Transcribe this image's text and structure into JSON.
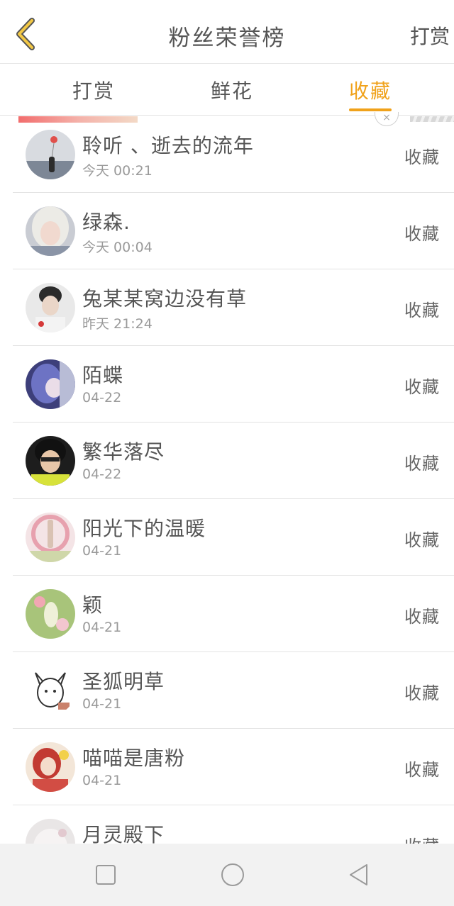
{
  "header": {
    "title": "粉丝荣誉榜",
    "right_action": "打赏"
  },
  "tabs": [
    {
      "label": "打赏"
    },
    {
      "label": "鲜花"
    },
    {
      "label": "收藏"
    }
  ],
  "active_tab": "收藏",
  "colors": {
    "accent": "#f0a21b",
    "text": "#555555",
    "muted": "#9a9a9a",
    "divider": "#e3e3e3"
  },
  "fans": [
    {
      "name": "聆听 、逝去的流年",
      "time": "今天 00:21",
      "action": "收藏"
    },
    {
      "name": "绿森.",
      "time": "今天 00:04",
      "action": "收藏"
    },
    {
      "name": "兔某某窝边没有草",
      "time": "昨天 21:24",
      "action": "收藏"
    },
    {
      "name": "陌蝶",
      "time": "04-22",
      "action": "收藏"
    },
    {
      "name": "繁华落尽",
      "time": "04-22",
      "action": "收藏"
    },
    {
      "name": "阳光下的温暖",
      "time": "04-21",
      "action": "收藏"
    },
    {
      "name": "颖",
      "time": "04-21",
      "action": "收藏"
    },
    {
      "name": "圣狐明草",
      "time": "04-21",
      "action": "收藏"
    },
    {
      "name": "喵喵是唐粉",
      "time": "04-21",
      "action": "收藏"
    },
    {
      "name": "月灵殿下",
      "time": "",
      "action": "收藏"
    }
  ],
  "icons": {
    "back": "chevron-left-icon",
    "nav_recent": "square-icon",
    "nav_home": "circle-icon",
    "nav_back": "triangle-left-icon"
  }
}
